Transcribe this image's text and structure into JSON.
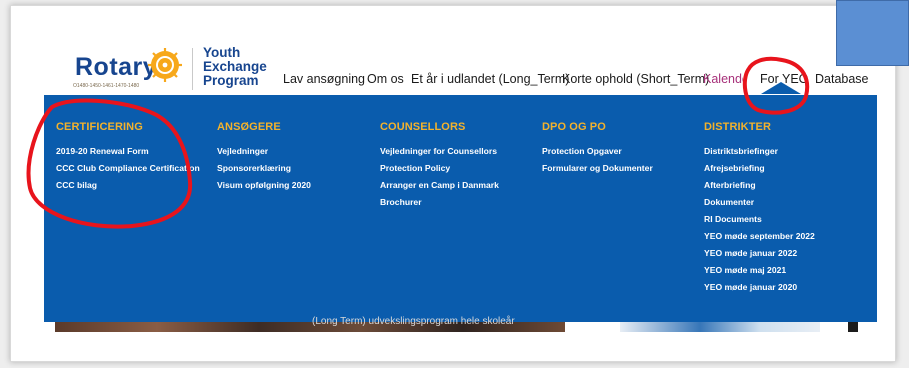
{
  "header": {
    "logo_word": "Rotary",
    "logo_years": "O1480-1450-1461-1470-1480",
    "yep_line1": "Youth",
    "yep_line2": "Exchange",
    "yep_line3": "Program"
  },
  "nav": {
    "items": [
      {
        "label": "Lav ansøgning"
      },
      {
        "label": "Om os"
      },
      {
        "label": "Et år i udlandet (Long_Term)"
      },
      {
        "label": "Korte ophold (Short_Term)"
      },
      {
        "label": "Kalender"
      },
      {
        "label": "For YEO"
      },
      {
        "label": "Database"
      }
    ],
    "kalender_color": "#a7307a"
  },
  "mega_menu": {
    "columns": [
      {
        "heading": "CERTIFICERING",
        "links": [
          "2019-20 Renewal Form",
          "CCC Club Compliance Certification",
          "CCC bilag"
        ]
      },
      {
        "heading": "ANSØGERE",
        "links": [
          "Vejledninger",
          "Sponsorerklæring",
          "Visum opfølgning 2020"
        ]
      },
      {
        "heading": "COUNSELLORS",
        "links": [
          "Vejledninger for Counsellors",
          "Protection Policy",
          "Arranger en Camp i Danmark",
          "Brochurer"
        ]
      },
      {
        "heading": "DPO OG PO",
        "links": [
          "Protection Opgaver",
          "Formularer og Dokumenter"
        ]
      },
      {
        "heading": "DISTRIKTER",
        "links": [
          "Distriktsbriefinger",
          "Afrejsebriefing",
          "Afterbriefing",
          "Dokumenter",
          "RI Documents",
          "YEO møde september 2022",
          "YEO møde januar 2022",
          "YEO møde maj 2021",
          "YEO møde januar 2020"
        ]
      }
    ],
    "background_color": "#0a5cad",
    "heading_color": "#f3b22c"
  },
  "background_strip": {
    "caption": "(Long Term) udvekslingsprogram hele skoleår"
  },
  "colors": {
    "annotation_red": "#e8141c",
    "brand_blue": "#17458f",
    "gold": "#f7a81b"
  }
}
